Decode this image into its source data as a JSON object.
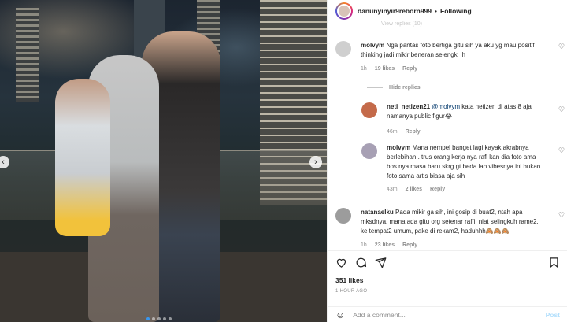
{
  "header": {
    "username": "danunyinyir9reborn999",
    "separator": "•",
    "follow_status": "Following"
  },
  "comments": {
    "view_replies_top": "View replies (10)",
    "items": [
      {
        "user": "molvym",
        "text": "Nga pantas foto bertiga gitu sih ya aku yg mau positif thinking jadi mikir beneran selengki ih",
        "time": "1h",
        "likes": "19 likes",
        "reply": "Reply"
      }
    ],
    "hide_replies": "Hide replies",
    "replies": [
      {
        "user": "neti_netizen21",
        "mention": "@molvym",
        "text": "kata netizen di atas 8 aja namanya public figur😂",
        "time": "46m",
        "reply": "Reply"
      },
      {
        "user": "molvym",
        "text": "Mana nempel banget lagi kayak akrabnya berlebihan.. trus orang kerja nya rafi kan dia foto ama bos nya masa baru skrg gt beda lah vibesnya ini bukan foto sama artis biasa aja sih",
        "time": "43m",
        "likes": "2 likes",
        "reply": "Reply"
      }
    ],
    "last": {
      "user": "natanaelku",
      "text": "Pada mikir ga sih, ini gosip di buat2, ntah apa mksdnya, mana ada gitu org setenar raffi, niat selingkuh rame2, ke tempat2 umum, pake di rekam2, haduhhh🙈🙈🙈",
      "time": "1h",
      "likes": "23 likes",
      "reply": "Reply"
    }
  },
  "footer": {
    "likes": "351 likes",
    "time_ago": "1 HOUR AGO",
    "add_comment_placeholder": "Add a comment...",
    "post_label": "Post"
  },
  "icons": {
    "heart": "heart-icon",
    "comment": "comment-icon",
    "share": "share-icon",
    "bookmark": "bookmark-icon",
    "emoji": "emoji-icon",
    "more": "more-icon"
  },
  "colors": {
    "post_disabled": "#b2dffc",
    "secondary_text": "#8e8e8e",
    "carousel_active_dot": "#3897f0"
  }
}
